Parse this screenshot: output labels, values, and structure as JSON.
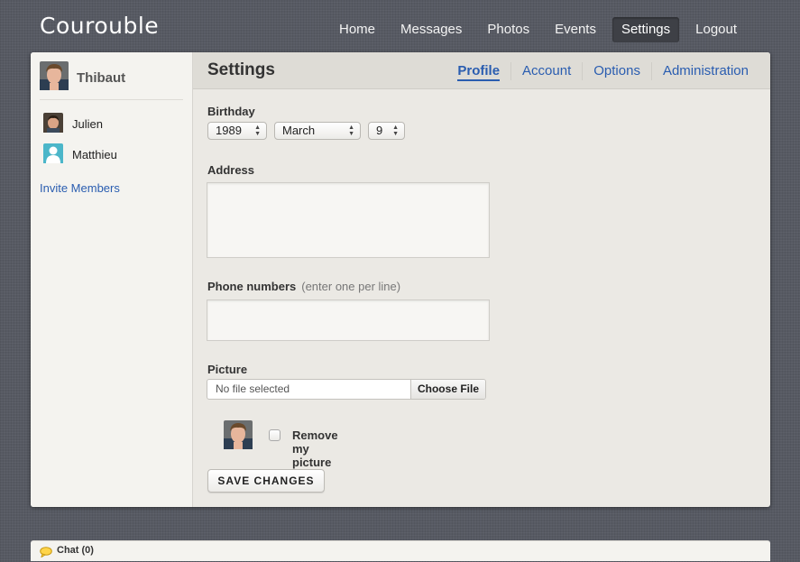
{
  "app": {
    "brand": "Courouble"
  },
  "topnav": {
    "items": [
      {
        "label": "Home"
      },
      {
        "label": "Messages"
      },
      {
        "label": "Photos"
      },
      {
        "label": "Events"
      },
      {
        "label": "Settings",
        "active": true
      },
      {
        "label": "Logout"
      }
    ]
  },
  "sidebar": {
    "user": {
      "name": "Thibaut",
      "avatar": "user-photo"
    },
    "members": [
      {
        "name": "Julien",
        "avatar": "user-photo"
      },
      {
        "name": "Matthieu",
        "avatar": "default-user-icon"
      }
    ],
    "invite_label": "Invite Members"
  },
  "main": {
    "title": "Settings",
    "tabs": [
      {
        "label": "Profile",
        "active": true
      },
      {
        "label": "Account"
      },
      {
        "label": "Options"
      },
      {
        "label": "Administration"
      }
    ]
  },
  "form": {
    "birthday": {
      "label": "Birthday",
      "year": "1989",
      "month": "March",
      "day": "9"
    },
    "address": {
      "label": "Address",
      "value": ""
    },
    "phone": {
      "label": "Phone numbers",
      "hint": "(enter one per line)",
      "value": ""
    },
    "picture": {
      "label": "Picture",
      "file_status": "No file selected",
      "choose_label": "Choose File",
      "remove_label": "Remove my picture",
      "remove_checked": false
    },
    "save_label": "SAVE CHANGES"
  },
  "chat": {
    "label": "Chat (0)",
    "icon": "speech-bubble-icon"
  },
  "colors": {
    "link": "#2a5db0",
    "background": "#575a63",
    "panel": "#ebe9e4",
    "sidebar": "#f4f3ef"
  }
}
